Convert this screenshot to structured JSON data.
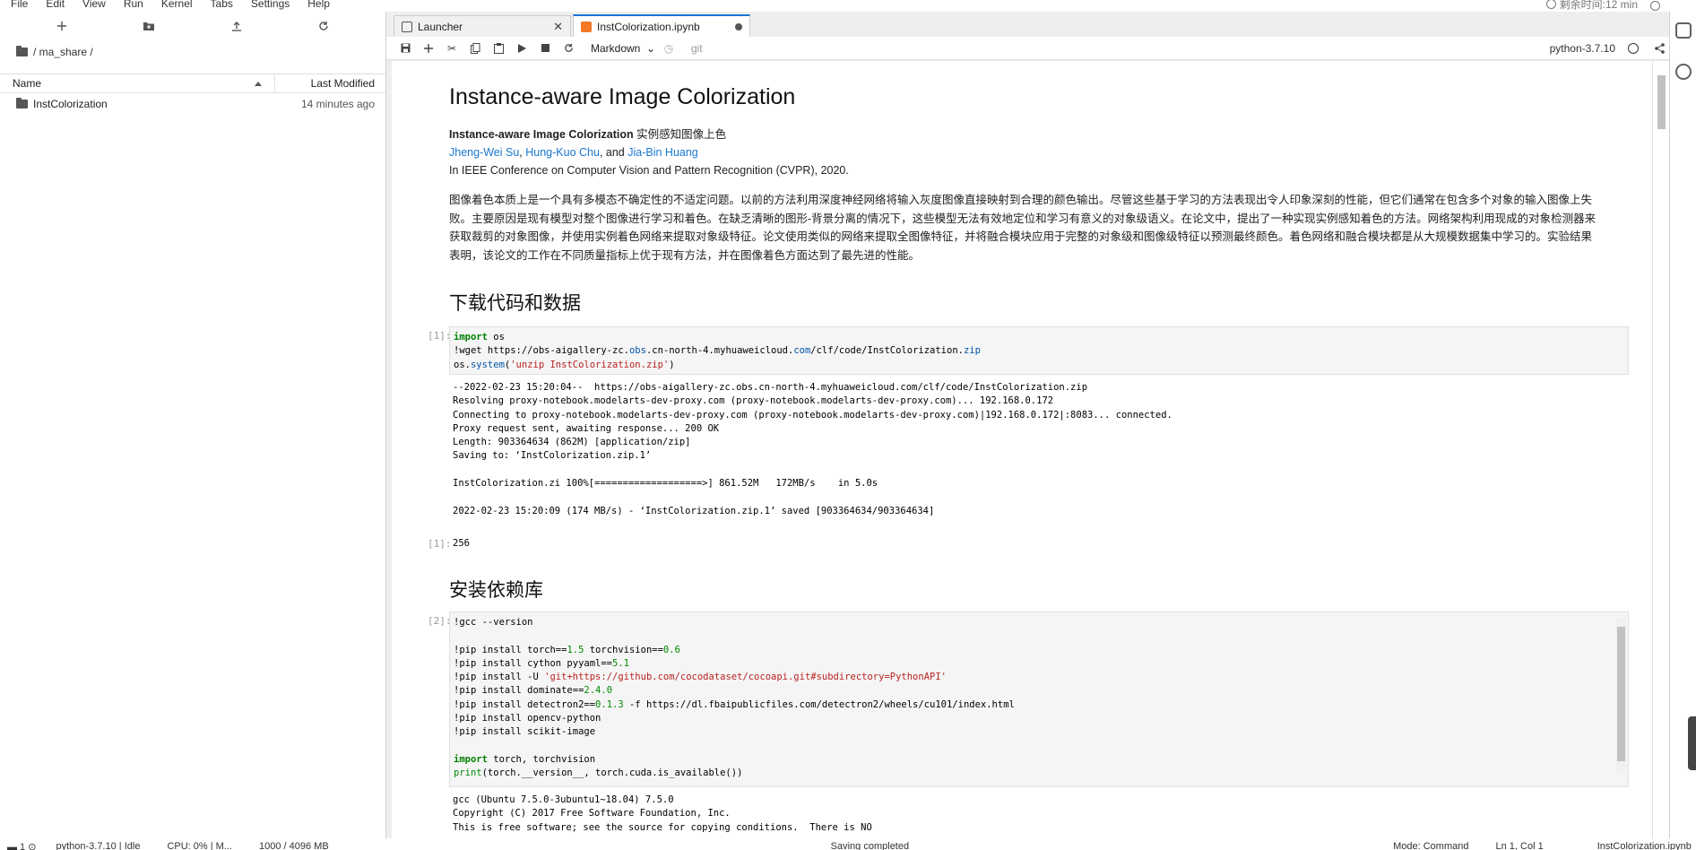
{
  "menu": {
    "items": [
      "File",
      "Edit",
      "View",
      "Run",
      "Kernel",
      "Tabs",
      "Settings",
      "Help"
    ],
    "timer": "剩余时间:12 min"
  },
  "filebrowser": {
    "breadcrumb": "/ ma_share /",
    "col_name": "Name",
    "col_modified": "Last Modified",
    "rows": [
      {
        "name": "InstColorization",
        "modified": "14 minutes ago"
      }
    ]
  },
  "tabs": [
    {
      "label": "Launcher"
    },
    {
      "label": "InstColorization.ipynb"
    }
  ],
  "toolbar": {
    "cell_type": "Markdown",
    "git": "git",
    "kernel": "python-3.7.10"
  },
  "notebook": {
    "title": "Instance-aware Image Colorization",
    "subtitle_bold": "Instance-aware Image Colorization",
    "subtitle_rest": " 实例感知图像上色",
    "authors": {
      "a1": "Jheng-Wei Su",
      "sep1": ", ",
      "a2": "Hung-Kuo Chu",
      "sep2": ", and ",
      "a3": "Jia-Bin Huang"
    },
    "venue": "In IEEE Conference on Computer Vision and Pattern Recognition (CVPR), 2020.",
    "abstract": [
      "图像着色本质上是一个具有多模态不确定性的不适定问题。以前的方法利用深度神经网络将输入灰度图像直接映射到合理的颜色输出。尽管这些基于学习的方法表现出令人印象深刻的性能，但它们通常在包含多个对象的输入图像上失",
      "败。主要原因是现有模型对整个图像进行学习和着色。在缺乏清晰的图形-背景分离的情况下，这些模型无法有效地定位和学习有意义的对象级语义。在论文中，提出了一种实现实例感知着色的方法。网络架构利用现成的对象检测器来",
      "获取裁剪的对象图像，并使用实例着色网络来提取对象级特征。论文使用类似的网络来提取全图像特征，并将融合模块应用于完整的对象级和图像级特征以预测最终颜色。着色网络和融合模块都是从大规模数据集中学习的。实验结果",
      "表明，该论文的工作在不同质量指标上优于现有方法，并在图像着色方面达到了最先进的性能。"
    ],
    "h2_download": "下载代码和数据",
    "h2_install": "安装依赖库",
    "prompt1": "[1]:",
    "prompt1_out": "[1]:",
    "prompt2": "[2]:",
    "cell1_code": [
      "import os",
      "!wget https://obs-aigallery-zc.obs.cn-north-4.myhuaweicloud.com/clf/code/InstColorization.zip",
      "os.system('unzip InstColorization.zip')"
    ],
    "cell1_output": "--2022-02-23 15:20:04--  https://obs-aigallery-zc.obs.cn-north-4.myhuaweicloud.com/clf/code/InstColorization.zip\nResolving proxy-notebook.modelarts-dev-proxy.com (proxy-notebook.modelarts-dev-proxy.com)... 192.168.0.172\nConnecting to proxy-notebook.modelarts-dev-proxy.com (proxy-notebook.modelarts-dev-proxy.com)|192.168.0.172|:8083... connected.\nProxy request sent, awaiting response... 200 OK\nLength: 903364634 (862M) [application/zip]\nSaving to: ‘InstColorization.zip.1’\n\nInstColorization.zi 100%[===================>] 861.52M   172MB/s    in 5.0s\n\n2022-02-23 15:20:09 (174 MB/s) - ‘InstColorization.zip.1’ saved [903364634/903364634]",
    "cell1_result": "256",
    "cell2_code": "!gcc --version\n\n!pip install torch==1.5 torchvision==0.6\n!pip install cython pyyaml==5.1\n!pip install -U 'git+https://github.com/cocodataset/cocoapi.git#subdirectory=PythonAPI'\n!pip install dominate==2.4.0\n!pip install detectron2==0.1.3 -f https://dl.fbaipublicfiles.com/detectron2/wheels/cu101/index.html\n!pip install opencv-python\n!pip install scikit-image\n\nimport torch, torchvision\nprint(torch.__version__, torch.cuda.is_available())",
    "cell2_output": "gcc (Ubuntu 7.5.0-3ubuntu1~18.04) 7.5.0\nCopyright (C) 2017 Free Software Foundation, Inc.\nThis is free software; see the source for copying conditions.  There is NO"
  },
  "status": {
    "kernel_status": "python-3.7.10 | Idle",
    "cpu": "CPU: 0% | M...",
    "mem": "1000 / 4096 MB",
    "saving": "Saving completed",
    "mode": "Mode: Command",
    "position": "Ln 1, Col 1",
    "file": "InstColorization.ipynb"
  }
}
